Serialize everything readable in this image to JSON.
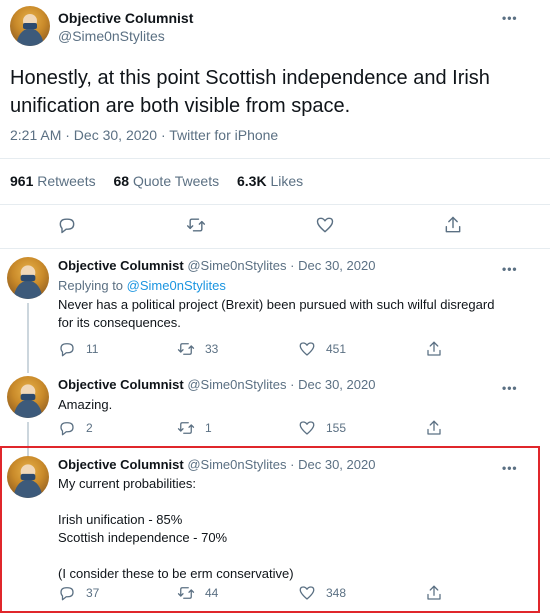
{
  "main_tweet": {
    "name": "Objective Columnist",
    "handle": "@Sime0nStylites",
    "text": "Honestly, at this point Scottish independence and Irish unification are both visible from space.",
    "meta": "2:21 AM · Dec 30, 2020 · Twitter for iPhone",
    "retweets_count": "961",
    "retweets_label": "Retweets",
    "quotes_count": "68",
    "quotes_label": "Quote Tweets",
    "likes_count": "6.3K",
    "likes_label": "Likes"
  },
  "replies": [
    {
      "name": "Objective Columnist",
      "handle": "@Sime0nStylites",
      "dot": "·",
      "date": "Dec 30, 2020",
      "replying_prefix": "Replying to",
      "replying_handle": "@Sime0nStylites",
      "lines": [
        "Never has a political project (Brexit) been pursued with such wilful disregard",
        "for its consequences."
      ],
      "replies": "11",
      "retweets": "33",
      "likes": "451"
    },
    {
      "name": "Objective Columnist",
      "handle": "@Sime0nStylites",
      "dot": "·",
      "date": "Dec 30, 2020",
      "lines": [
        "Amazing."
      ],
      "replies": "2",
      "retweets": "1",
      "likes": "155"
    },
    {
      "name": "Objective Columnist",
      "handle": "@Sime0nStylites",
      "dot": "·",
      "date": "Dec 30, 2020",
      "lines": [
        "My current probabilities:",
        "",
        "Irish unification - 85%",
        "Scottish independence - 70%",
        "",
        "(I consider these to be erm conservative)"
      ],
      "replies": "37",
      "retweets": "44",
      "likes": "348"
    }
  ],
  "more_glyph": "•••",
  "colors": {
    "highlight": "#e0262b",
    "link": "#1b95e0",
    "muted": "#5b7083"
  }
}
